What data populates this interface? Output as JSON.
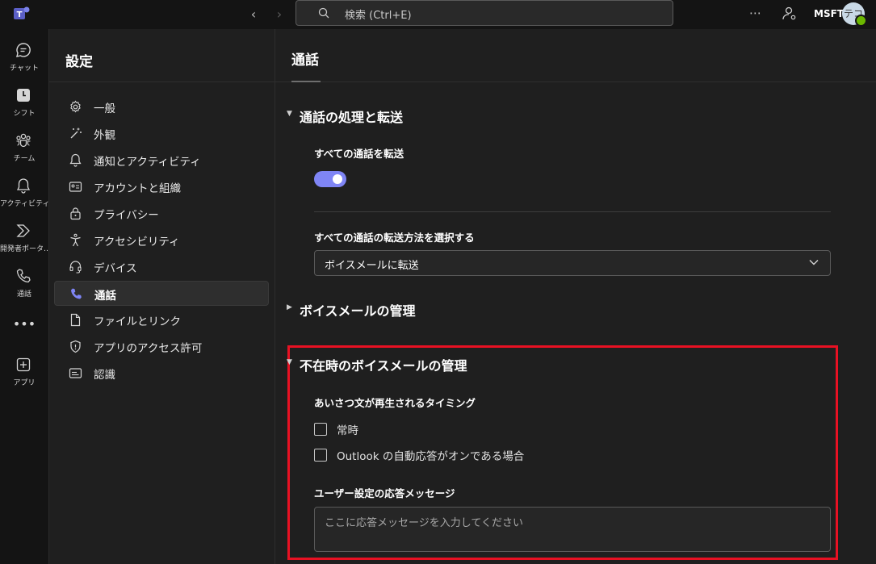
{
  "topbar": {
    "search_placeholder": "検索 (Ctrl+E)",
    "more": "⋯",
    "org": "MSFT",
    "avatar_initials": "テコ"
  },
  "rail": {
    "items": [
      {
        "label": "チャット",
        "icon": "chat-icon"
      },
      {
        "label": "シフト",
        "icon": "shifts-icon"
      },
      {
        "label": "チーム",
        "icon": "teams-icon"
      },
      {
        "label": "アクティビティ",
        "icon": "bell-icon"
      },
      {
        "label": "開発者ポータ…",
        "icon": "developer-portal-icon"
      },
      {
        "label": "通話",
        "icon": "phone-icon"
      },
      {
        "label": "アプリ",
        "icon": "add-app-icon"
      }
    ],
    "more": "•••"
  },
  "settings": {
    "title": "設定",
    "items": [
      {
        "label": "一般",
        "icon": "gear-icon"
      },
      {
        "label": "外観",
        "icon": "wand-icon"
      },
      {
        "label": "通知とアクティビティ",
        "icon": "bell-icon"
      },
      {
        "label": "アカウントと組織",
        "icon": "id-card-icon"
      },
      {
        "label": "プライバシー",
        "icon": "lock-icon"
      },
      {
        "label": "アクセシビリティ",
        "icon": "accessibility-icon"
      },
      {
        "label": "デバイス",
        "icon": "headset-icon"
      },
      {
        "label": "通話",
        "icon": "phone-icon"
      },
      {
        "label": "ファイルとリンク",
        "icon": "file-icon"
      },
      {
        "label": "アプリのアクセス許可",
        "icon": "shield-icon"
      },
      {
        "label": "認識",
        "icon": "caption-icon"
      }
    ],
    "active_index": 7
  },
  "main": {
    "title": "通話",
    "sections": {
      "call_handling": {
        "title": "通話の処理と転送",
        "forward_all_label": "すべての通話を転送",
        "forward_all_on": true,
        "forward_method_label": "すべての通話の転送方法を選択する",
        "forward_method_value": "ボイスメールに転送"
      },
      "voicemail": {
        "title": "ボイスメールの管理"
      },
      "ooo_voicemail": {
        "title": "不在時のボイスメールの管理",
        "greeting_timing_label": "あいさつ文が再生されるタイミング",
        "options": [
          "常時",
          "Outlook の自動応答がオンである場合"
        ],
        "custom_message_label": "ユーザー設定の応答メッセージ",
        "custom_message_placeholder": "ここに応答メッセージを入力してください"
      }
    }
  },
  "colors": {
    "accent": "#7f85f5",
    "highlight_border": "#e81123",
    "background": "#1f1f1f"
  }
}
